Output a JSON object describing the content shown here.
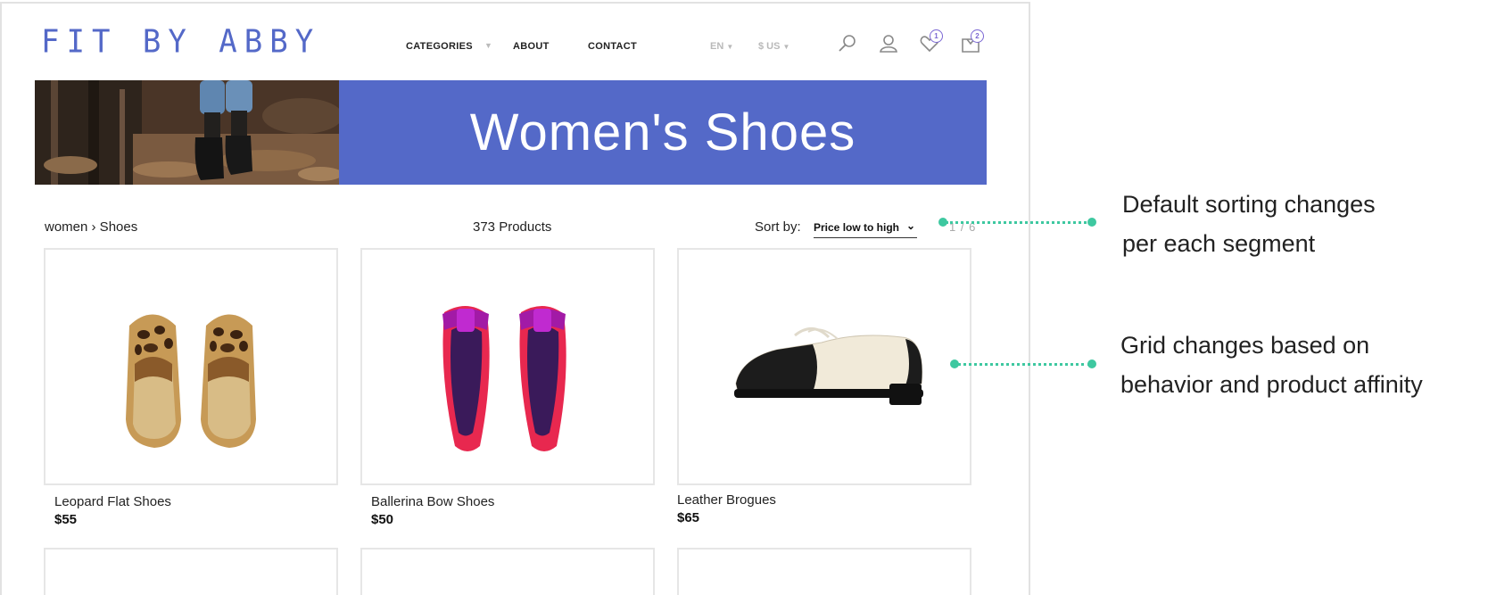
{
  "brand": {
    "logo_text": "FIT BY ABBY"
  },
  "nav": {
    "categories": "CATEGORIES",
    "about": "ABOUT",
    "contact": "CONTACT"
  },
  "utility": {
    "language": "EN",
    "currency": "$ US",
    "wishlist_count": "1",
    "cart_count": "2"
  },
  "banner": {
    "title": "Women's Shoes"
  },
  "listing": {
    "breadcrumb": "women › Shoes",
    "product_count": "373 Products",
    "sort_label": "Sort by:",
    "sort_value": "Price low to high",
    "pager": "1 / 6"
  },
  "products": [
    {
      "name": "Leopard Flat Shoes",
      "price": "$55"
    },
    {
      "name": "Ballerina Bow Shoes",
      "price": "$50"
    },
    {
      "name": "Leather Brogues",
      "price": "$65"
    }
  ],
  "annotations": [
    {
      "line1": "Default sorting changes",
      "line2": "per each segment"
    },
    {
      "line1": "Grid changes based on",
      "line2": "behavior and product affinity"
    }
  ],
  "colors": {
    "brand_blue": "#5469c8",
    "annotation_green": "#3ec8a0",
    "badge_purple": "#7a66d3"
  }
}
